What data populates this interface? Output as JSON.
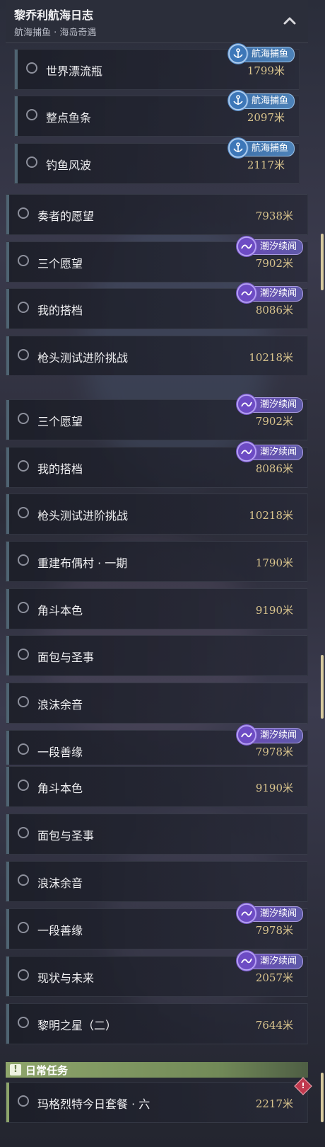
{
  "header": {
    "title": "黎乔利航海日志",
    "subtitle": "航海捕鱼 · 海岛奇遇"
  },
  "daily_label": "日常任务",
  "tags": {
    "fishing": "航海捕鱼",
    "tide": "潮汐续闻"
  },
  "segment1": {
    "rows": [
      {
        "name": "世界漂流瓶",
        "dist": "1799米"
      },
      {
        "name": "整点鱼条",
        "dist": "2097米"
      },
      {
        "name": "钓鱼风波",
        "dist": "2117米"
      },
      {
        "name": "奏者的愿望",
        "dist": "7938米"
      },
      {
        "name": "三个愿望",
        "dist": "7902米"
      },
      {
        "name": "我的搭档",
        "dist": "8086米"
      },
      {
        "name": "枪头测试进阶挑战",
        "dist": "10218米"
      }
    ]
  },
  "segment2": {
    "rows": [
      {
        "name": "三个愿望",
        "dist": "7902米"
      },
      {
        "name": "我的搭档",
        "dist": "8086米"
      },
      {
        "name": "枪头测试进阶挑战",
        "dist": "10218米"
      },
      {
        "name": "重建布偶村 · 一期",
        "dist": "1790米"
      },
      {
        "name": "角斗本色",
        "dist": "9190米"
      },
      {
        "name": "面包与圣事",
        "dist": ""
      },
      {
        "name": "浪沫余音",
        "dist": ""
      },
      {
        "name": "一段善缘",
        "dist": "7978米"
      }
    ]
  },
  "segment3": {
    "rows": [
      {
        "name": "角斗本色",
        "dist": "9190米"
      },
      {
        "name": "面包与圣事",
        "dist": ""
      },
      {
        "name": "浪沫余音",
        "dist": ""
      },
      {
        "name": "一段善缘",
        "dist": "7978米"
      },
      {
        "name": "现状与未来",
        "dist": "2057米"
      },
      {
        "name": "黎明之星（二）",
        "dist": "7644米"
      }
    ]
  },
  "daily_rows": [
    {
      "name": "玛格烈特今日套餐 · 六",
      "dist": "2217米"
    }
  ],
  "colors": {
    "accent_gold": "#dac58e",
    "tide_purple": "#6b4ab8",
    "fishing_blue": "#3d6fa8",
    "daily_green": "#8ea56b"
  }
}
